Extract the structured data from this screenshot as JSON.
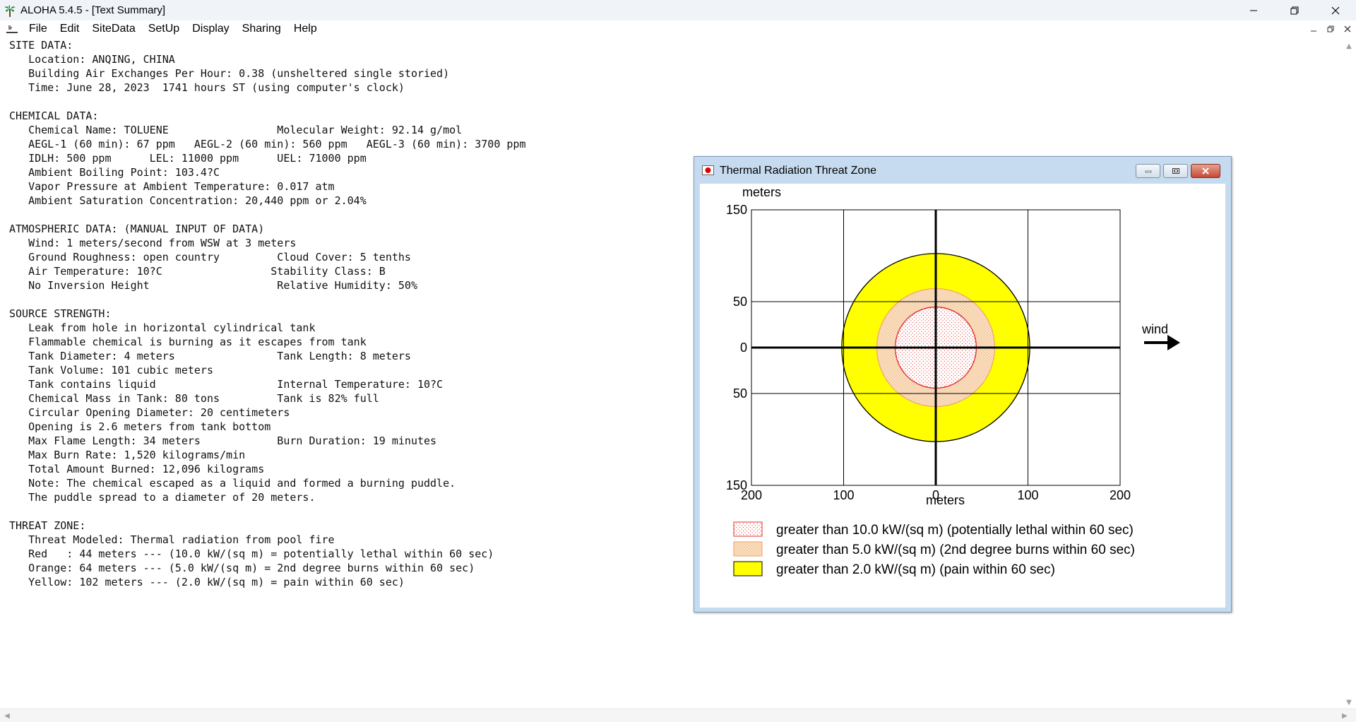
{
  "window": {
    "title": "ALOHA 5.4.5 - [Text Summary]",
    "app_icon": "palm-tree-icon",
    "controls": [
      "minimize-icon",
      "restore-icon",
      "close-icon"
    ]
  },
  "menu": {
    "items": [
      "File",
      "Edit",
      "SiteData",
      "SetUp",
      "Display",
      "Sharing",
      "Help"
    ]
  },
  "summary": {
    "lines": [
      "SITE DATA:",
      "   Location: ANQING, CHINA",
      "   Building Air Exchanges Per Hour: 0.38 (unsheltered single storied)",
      "   Time: June 28, 2023  1741 hours ST (using computer's clock)",
      "",
      "CHEMICAL DATA:",
      "   Chemical Name: TOLUENE                 Molecular Weight: 92.14 g/mol",
      "   AEGL-1 (60 min): 67 ppm   AEGL-2 (60 min): 560 ppm   AEGL-3 (60 min): 3700 ppm",
      "   IDLH: 500 ppm      LEL: 11000 ppm      UEL: 71000 ppm",
      "   Ambient Boiling Point: 103.4?C",
      "   Vapor Pressure at Ambient Temperature: 0.017 atm",
      "   Ambient Saturation Concentration: 20,440 ppm or 2.04%",
      "",
      "ATMOSPHERIC DATA: (MANUAL INPUT OF DATA)",
      "   Wind: 1 meters/second from WSW at 3 meters",
      "   Ground Roughness: open country         Cloud Cover: 5 tenths",
      "   Air Temperature: 10?C                 Stability Class: B",
      "   No Inversion Height                    Relative Humidity: 50%",
      "",
      "SOURCE STRENGTH:",
      "   Leak from hole in horizontal cylindrical tank",
      "   Flammable chemical is burning as it escapes from tank",
      "   Tank Diameter: 4 meters                Tank Length: 8 meters",
      "   Tank Volume: 101 cubic meters",
      "   Tank contains liquid                   Internal Temperature: 10?C",
      "   Chemical Mass in Tank: 80 tons         Tank is 82% full",
      "   Circular Opening Diameter: 20 centimeters",
      "   Opening is 2.6 meters from tank bottom",
      "   Max Flame Length: 34 meters            Burn Duration: 19 minutes",
      "   Max Burn Rate: 1,520 kilograms/min",
      "   Total Amount Burned: 12,096 kilograms",
      "   Note: The chemical escaped as a liquid and formed a burning puddle.",
      "   The puddle spread to a diameter of 20 meters.",
      "",
      "THREAT ZONE:",
      "   Threat Modeled: Thermal radiation from pool fire",
      "   Red   : 44 meters --- (10.0 kW/(sq m) = potentially lethal within 60 sec)",
      "   Orange: 64 meters --- (5.0 kW/(sq m) = 2nd degree burns within 60 sec)",
      "   Yellow: 102 meters --- (2.0 kW/(sq m) = pain within 60 sec)"
    ]
  },
  "threat_window": {
    "title": "Thermal Radiation Threat Zone",
    "y_unit": "meters",
    "x_unit": "meters",
    "y_ticks": [
      "150",
      "50",
      "0",
      "50",
      "150"
    ],
    "x_ticks": [
      "200",
      "100",
      "0",
      "100",
      "200"
    ],
    "wind_label": "wind",
    "legend": [
      "greater than 10.0 kW/(sq m) (potentially lethal within 60 sec)",
      "greater than 5.0 kW/(sq m) (2nd degree burns within 60 sec)",
      "greater than 2.0 kW/(sq m) (pain within 60 sec)"
    ]
  },
  "chart_data": {
    "type": "scatter",
    "title": "Thermal Radiation Threat Zone",
    "xlabel": "meters",
    "ylabel": "meters",
    "xlim": [
      -200,
      200
    ],
    "ylim": [
      -150,
      150
    ],
    "grid": true,
    "zones": [
      {
        "name": "Yellow",
        "radius_m": 102,
        "color": "#ffff00",
        "threshold": "2.0 kW/(sq m)"
      },
      {
        "name": "Orange",
        "radius_m": 64,
        "color": "#f7d9b4",
        "threshold": "5.0 kW/(sq m)"
      },
      {
        "name": "Red",
        "radius_m": 44,
        "color": "#e8262a",
        "threshold": "10.0 kW/(sq m)"
      }
    ],
    "wind_direction": "right"
  }
}
